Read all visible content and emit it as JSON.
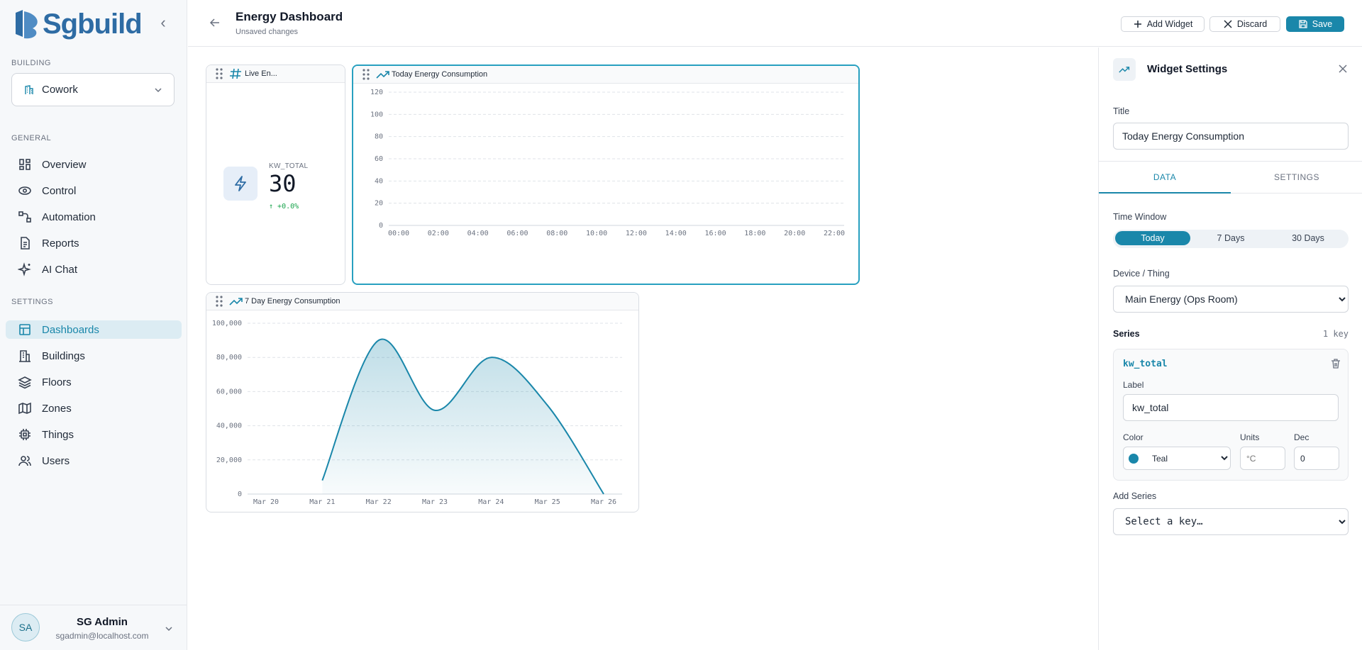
{
  "sidebar": {
    "logo_text": "Sgbuild",
    "building_section": "BUILDING",
    "building_value": "Cowork",
    "general_section": "GENERAL",
    "settings_section": "SETTINGS",
    "general_items": [
      {
        "label": "Overview",
        "icon": "grid-icon"
      },
      {
        "label": "Control",
        "icon": "eye-icon"
      },
      {
        "label": "Automation",
        "icon": "flow-icon"
      },
      {
        "label": "Reports",
        "icon": "document-icon"
      },
      {
        "label": "AI Chat",
        "icon": "sparkle-icon"
      }
    ],
    "settings_items": [
      {
        "label": "Dashboards",
        "icon": "layout-icon",
        "active": true
      },
      {
        "label": "Buildings",
        "icon": "building-icon"
      },
      {
        "label": "Floors",
        "icon": "layers-icon"
      },
      {
        "label": "Zones",
        "icon": "map-icon"
      },
      {
        "label": "Things",
        "icon": "chip-icon"
      },
      {
        "label": "Users",
        "icon": "users-icon"
      }
    ],
    "user": {
      "initials": "SA",
      "name": "SG Admin",
      "email": "sgadmin@localhost.com"
    }
  },
  "header": {
    "title": "Energy Dashboard",
    "subtitle": "Unsaved changes",
    "add_widget": "Add Widget",
    "discard": "Discard",
    "save": "Save"
  },
  "widgets": {
    "kpi": {
      "title": "Live En...",
      "key_label": "KW_TOTAL",
      "value": "30",
      "trend": "+0.0%"
    },
    "today": {
      "title": "Today Energy Consumption"
    },
    "week": {
      "title": "7 Day Energy Consumption"
    }
  },
  "chart_data": [
    {
      "type": "line",
      "x": [
        "00:00",
        "02:00",
        "04:00",
        "06:00",
        "08:00",
        "10:00",
        "12:00",
        "14:00",
        "16:00",
        "18:00",
        "20:00",
        "22:00"
      ],
      "ylim": [
        0,
        120
      ],
      "yticks": [
        "0",
        "20",
        "40",
        "60",
        "80",
        "100",
        "120"
      ],
      "series": [],
      "grid": true
    },
    {
      "type": "area",
      "x": [
        "Mar 20",
        "Mar 21",
        "Mar 22",
        "Mar 23",
        "Mar 24",
        "Mar 25",
        "Mar 26"
      ],
      "ylim": [
        0,
        100000
      ],
      "yticks": [
        "0",
        "20,000",
        "40,000",
        "60,000",
        "80,000",
        "100,000"
      ],
      "series": [
        {
          "points": [
            [
              "Mar 21",
              8000
            ],
            [
              "Mar 22",
              90000
            ],
            [
              "Mar 23",
              49000
            ],
            [
              "Mar 24",
              80000
            ],
            [
              "Mar 25",
              52000
            ],
            [
              "Mar 26",
              0
            ]
          ]
        }
      ],
      "color": "#1a87aa",
      "grid": true
    }
  ],
  "panel": {
    "title": "Widget Settings",
    "title_label": "Title",
    "title_value": "Today Energy Consumption",
    "tabs": [
      "DATA",
      "SETTINGS"
    ],
    "time_window_label": "Time Window",
    "time_windows": [
      "Today",
      "7 Days",
      "30 Days"
    ],
    "device_label": "Device / Thing",
    "device_value": "Main Energy (Ops Room)",
    "series_label": "Series",
    "series_count": "1 key",
    "series_key": "kw_total",
    "label_label": "Label",
    "label_value": "kw_total",
    "color_label": "Color",
    "color_value": "Teal",
    "units_label": "Units",
    "units_placeholder": "°C",
    "dec_label": "Dec",
    "dec_value": "0",
    "add_series_label": "Add Series",
    "add_series_placeholder": "Select a key…"
  }
}
